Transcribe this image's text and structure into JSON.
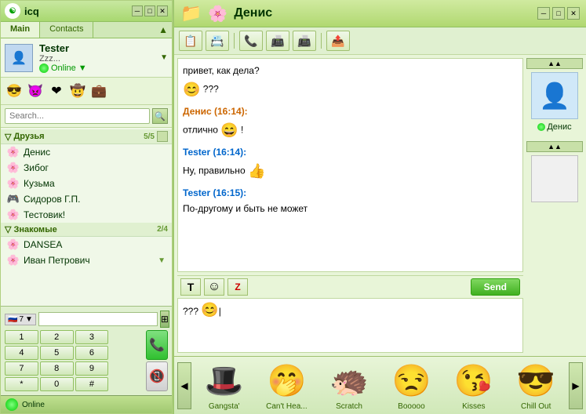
{
  "app": {
    "title": "icq",
    "logo": "☯"
  },
  "left": {
    "tabs": [
      {
        "label": "Main",
        "active": true
      },
      {
        "label": "Contacts",
        "active": false
      }
    ],
    "user": {
      "name": "Tester",
      "status": "Zzz...",
      "online_label": "Online",
      "avatar_icon": "👤"
    },
    "emoticons": [
      "😎",
      "👿",
      "❤",
      "🤠",
      "💼"
    ],
    "search_placeholder": "Search...",
    "groups": [
      {
        "name": "Друзья",
        "count": "5/5",
        "contacts": [
          {
            "name": "Денис",
            "icon": "🌸"
          },
          {
            "name": "Зибог",
            "icon": "🌸"
          },
          {
            "name": "Кузьма",
            "icon": "🌸"
          },
          {
            "name": "Сидоров Г.П.",
            "icon": "🎮"
          },
          {
            "name": "Тестовик!",
            "icon": "🌸"
          }
        ]
      },
      {
        "name": "Знакомые",
        "count": "2/4",
        "contacts": [
          {
            "name": "DANSEA",
            "icon": "🌸"
          },
          {
            "name": "Иван Петрович",
            "icon": "🌸"
          }
        ]
      }
    ],
    "phone": {
      "country_code": "7",
      "keys": [
        "1",
        "2",
        "3",
        "",
        "4",
        "5",
        "6",
        "",
        "7",
        "8",
        "9",
        "",
        "*",
        "0",
        "#",
        ""
      ]
    }
  },
  "chat": {
    "title": "Денис",
    "title_icon": "📁",
    "toolbar_icons": [
      "📋",
      "📇",
      "📞",
      "📠",
      "📠",
      "📤"
    ],
    "messages": [
      {
        "type": "text",
        "text": "привет, как дела?"
      },
      {
        "type": "emoji_line",
        "text": "😊 ???"
      },
      {
        "type": "sender",
        "name": "Денис (16:14):",
        "color": "denis"
      },
      {
        "type": "text",
        "text": "отлично 😄 !"
      },
      {
        "type": "sender",
        "name": "Tester (16:14):",
        "color": "tester"
      },
      {
        "type": "text_emoji",
        "text": "Ну, правильно 👍"
      },
      {
        "type": "sender",
        "name": "Tester (16:15):",
        "color": "tester"
      },
      {
        "type": "text",
        "text": "По-другому и быть не может"
      }
    ],
    "input_text": "??? 😊",
    "input_placeholder": "",
    "send_label": "Send",
    "side_avatar_name": "Денис",
    "emoticons_strip": [
      {
        "label": "Gangsta'",
        "emoji": "🎩"
      },
      {
        "label": "Can't Hea...",
        "emoji": "🤭"
      },
      {
        "label": "Scratch",
        "emoji": "🦔"
      },
      {
        "label": "Booooo",
        "emoji": "😒"
      },
      {
        "label": "Kisses",
        "emoji": "😘"
      },
      {
        "label": "Chill Out",
        "emoji": "😎"
      }
    ]
  },
  "icons": {
    "minimize": "─",
    "maximize": "□",
    "close": "✕",
    "arrow_down": "▼",
    "arrow_right": "▶",
    "scroll_up": "▲",
    "scroll_down": "▼",
    "nav_left": "◀",
    "nav_right": "▶",
    "search": "🔍",
    "bold_T": "T",
    "smiley": "☺",
    "z_icon": "Z"
  }
}
